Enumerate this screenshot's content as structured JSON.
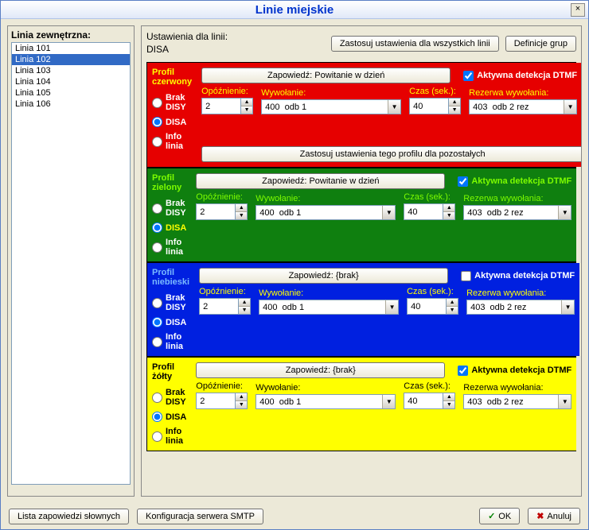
{
  "window": {
    "title": "Linie miejskie",
    "close": "×"
  },
  "left": {
    "label": "Linia zewnętrzna:",
    "items": [
      "Linia 101",
      "Linia 102",
      "Linia 103",
      "Linia 104",
      "Linia 105",
      "Linia 106"
    ],
    "selected_index": 1
  },
  "header": {
    "settings_for": "Ustawienia dla linii:",
    "line_name": "DISA",
    "apply_all": "Zastosuj ustawienia dla wszystkich linii",
    "group_defs": "Definicje grup"
  },
  "labels": {
    "delay": "Opóźnienie:",
    "call": "Wywołanie:",
    "time": "Czas (sek.):",
    "reserve": "Rezerwa wywołania:",
    "active_dtmf": "Aktywna detekcja DTMF",
    "brak_disy": "Brak DISY",
    "disa": "DISA",
    "info_linia": "Info linia",
    "apply_rest": "Zastosuj ustawienia tego profilu dla pozostałych"
  },
  "profiles": {
    "red": {
      "title": "Profil czerwony",
      "mode": "DISA",
      "announce": "Zapowiedź: Powitanie w dzień",
      "dtmf": true,
      "delay": "2",
      "call": "400  odb 1",
      "time": "40",
      "reserve": "403  odb 2 rez"
    },
    "green": {
      "title": "Profil zielony",
      "mode": "DISA",
      "announce": "Zapowiedź: Powitanie w dzień",
      "dtmf": true,
      "delay": "2",
      "call": "400  odb 1",
      "time": "40",
      "reserve": "403  odb 2 rez"
    },
    "blue": {
      "title": "Profil niebieski",
      "mode": "DISA",
      "announce": "Zapowiedź: {brak}",
      "dtmf": false,
      "delay": "2",
      "call": "400  odb 1",
      "time": "40",
      "reserve": "403  odb 2 rez"
    },
    "yellow": {
      "title": "Profil żółty",
      "mode": "DISA",
      "announce": "Zapowiedź: {brak}",
      "dtmf": true,
      "delay": "2",
      "call": "400  odb 1",
      "time": "40",
      "reserve": "403  odb 2 rez"
    }
  },
  "footer": {
    "voice_list": "Lista zapowiedzi słownych",
    "smtp_conf": "Konfiguracja serwera SMTP",
    "ok": "OK",
    "cancel": "Anuluj"
  }
}
